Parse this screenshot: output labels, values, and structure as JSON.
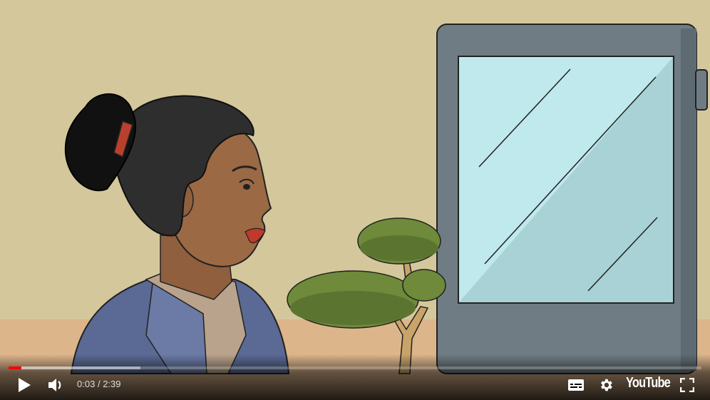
{
  "player": {
    "progress_fraction": 0.019,
    "buffered_fraction": 0.19,
    "time": {
      "current": "0:03",
      "separator": "/",
      "duration": "2:39"
    },
    "logo_text": "YouTube",
    "icons": {
      "play": "play-icon",
      "volume": "volume-icon",
      "captions": "captions-icon",
      "settings": "gear-icon",
      "fullscreen": "fullscreen-icon"
    },
    "colors": {
      "progress_played": "#ff0000",
      "background": "#d4c79b"
    }
  }
}
